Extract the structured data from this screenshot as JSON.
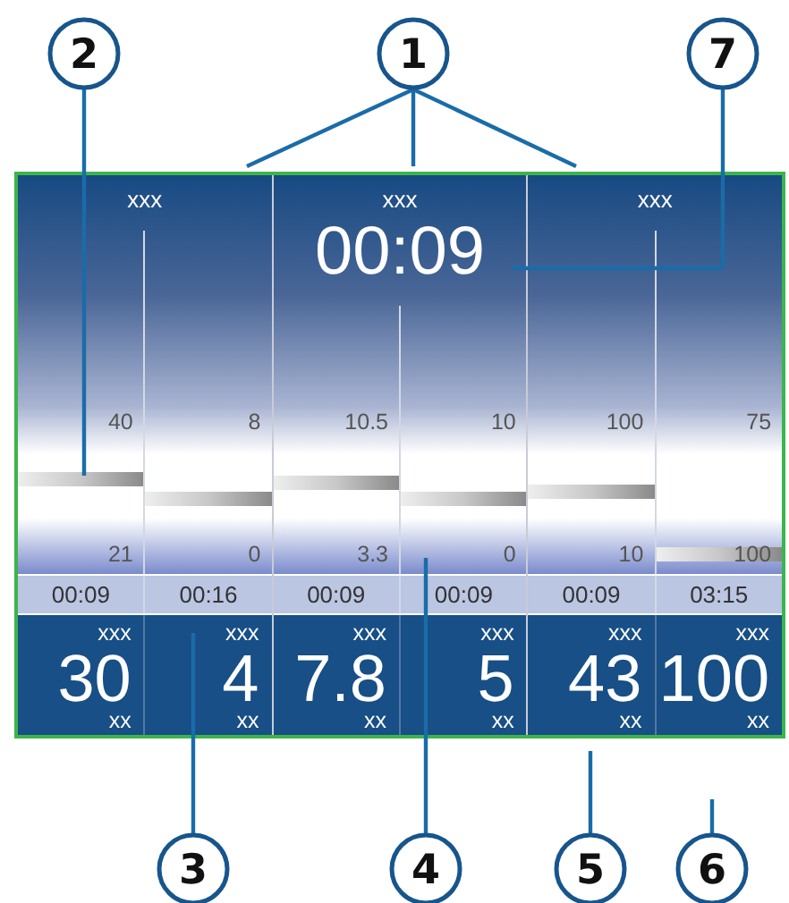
{
  "groups": [
    {
      "label": "xxx",
      "columns": [
        {
          "max": "40",
          "min": "21",
          "time": "00:09",
          "unit_top": "xxx",
          "value": "30",
          "unit_bottom": "xx"
        },
        {
          "max": "8",
          "min": "0",
          "time": "00:16",
          "unit_top": "xxx",
          "value": "4",
          "unit_bottom": "xx"
        }
      ]
    },
    {
      "label": "xxx",
      "timer": "00:09",
      "columns": [
        {
          "max": "10.5",
          "min": "3.3",
          "time": "00:09",
          "unit_top": "xxx",
          "value": "7.8",
          "unit_bottom": "xx"
        },
        {
          "max": "10",
          "min": "0",
          "time": "00:09",
          "unit_top": "xxx",
          "value": "5",
          "unit_bottom": "xx"
        }
      ]
    },
    {
      "label": "xxx",
      "columns": [
        {
          "max": "100",
          "min": "10",
          "time": "00:09",
          "unit_top": "xxx",
          "value": "43",
          "unit_bottom": "xx"
        },
        {
          "max": "75",
          "min": "100",
          "time": "03:15",
          "unit_top": "xxx",
          "value": "100",
          "unit_bottom": "xx"
        }
      ]
    }
  ],
  "callouts": [
    {
      "number": "2"
    },
    {
      "number": "1"
    },
    {
      "number": "7"
    },
    {
      "number": "3"
    },
    {
      "number": "4"
    },
    {
      "number": "5"
    },
    {
      "number": "6"
    }
  ]
}
